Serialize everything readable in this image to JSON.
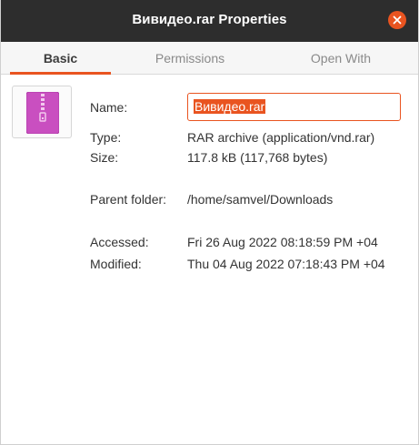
{
  "window": {
    "title": "Вивидео.rar Properties"
  },
  "tabs": [
    {
      "label": "Basic",
      "active": true
    },
    {
      "label": "Permissions",
      "active": false
    },
    {
      "label": "Open With",
      "active": false
    }
  ],
  "file": {
    "icon": "archive-zip-icon",
    "name_label": "Name:",
    "name_value": "Вивидео.rar",
    "type_label": "Type:",
    "type_value": "RAR archive (application/vnd.rar)",
    "size_label": "Size:",
    "size_value": "117.8 kB (117,768 bytes)",
    "parent_label": "Parent folder:",
    "parent_value": "/home/samvel/Downloads",
    "accessed_label": "Accessed:",
    "accessed_value": "Fri 26 Aug 2022 08:18:59 PM +04",
    "modified_label": "Modified:",
    "modified_value": "Thu 04 Aug 2022 07:18:43 PM +04"
  },
  "colors": {
    "accent": "#e95420",
    "titlebar": "#2d2d2d",
    "archive_icon": "#c94fc0"
  }
}
